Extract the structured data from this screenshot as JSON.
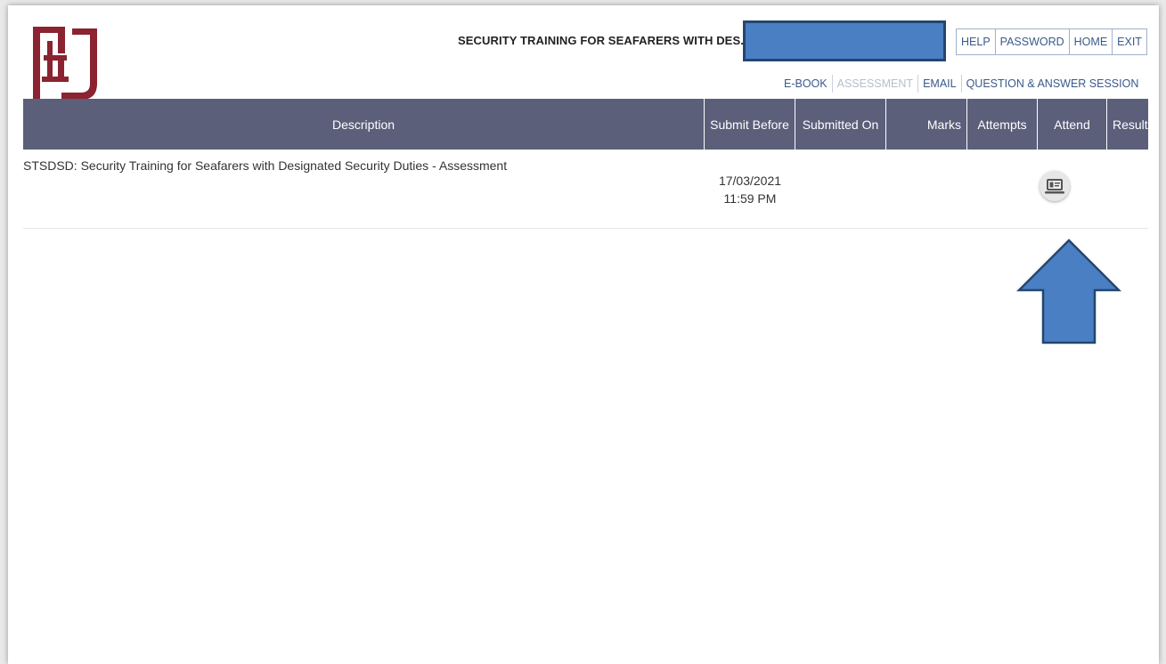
{
  "header": {
    "course_title": "SECURITY TRAINING FOR SEAFARERS WITH DES...",
    "top_nav": [
      "HELP",
      "PASSWORD",
      "HOME",
      "EXIT"
    ],
    "sub_nav": [
      {
        "label": "E-BOOK",
        "enabled": true
      },
      {
        "label": "ASSESSMENT",
        "enabled": false
      },
      {
        "label": "EMAIL",
        "enabled": true
      },
      {
        "label": "QUESTION & ANSWER SESSION",
        "enabled": true
      }
    ]
  },
  "table": {
    "columns": [
      "Description",
      "Submit Before",
      "Submitted On",
      "Marks",
      "Attempts",
      "Attend",
      "Result"
    ],
    "rows": [
      {
        "description": "STSDSD: Security Training for Seafarers with Designated Security Duties - Assessment",
        "submit_before_date": "17/03/2021",
        "submit_before_time": "11:59 PM",
        "submitted_on": "",
        "marks": "",
        "attempts": "",
        "attend_icon": "computer-icon",
        "result": ""
      }
    ]
  },
  "annotation": {
    "arrow_color": "#4a7fc3",
    "arrow_border": "#24466f"
  },
  "colors": {
    "header_bg": "#5b5f7a",
    "logo": "#8b2330",
    "link": "#3a5a8a",
    "redaction": "#4a7fc3"
  }
}
